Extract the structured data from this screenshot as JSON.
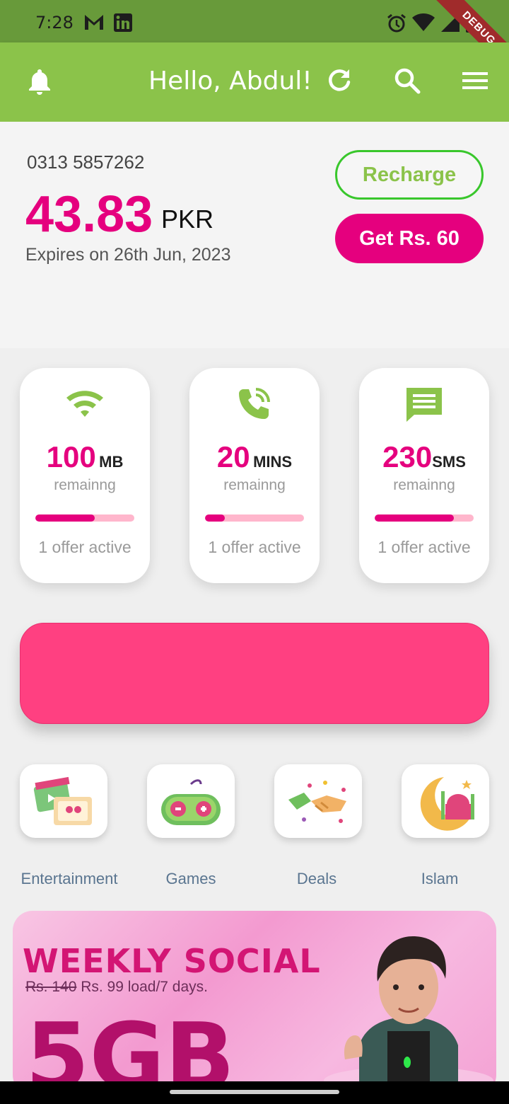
{
  "status_bar": {
    "time": "7:28",
    "debug_label": "DEBUG",
    "icons": [
      "gmail-icon",
      "linkedin-icon",
      "alarm-icon",
      "wifi-icon",
      "signal-icon",
      "battery-icon"
    ]
  },
  "app_bar": {
    "title": "Hello, Abdul!",
    "icons": [
      "bell-icon",
      "refresh-icon",
      "search-icon",
      "menu-icon"
    ],
    "color": "#8bc34a"
  },
  "account": {
    "phone_number": "0313 5857262",
    "balance": "43.83",
    "currency": "PKR",
    "expiry": "Expires on 26th Jun, 2023",
    "recharge_label": "Recharge",
    "get_label": "Get Rs. 60"
  },
  "usage": [
    {
      "icon": "wifi-icon",
      "amount": "100",
      "unit": "MB",
      "remaining_label": "remainng",
      "offer_label": "1 offer active",
      "progress": 0.6
    },
    {
      "icon": "phone-call-icon",
      "amount": "20",
      "unit": "MINS",
      "remaining_label": "remainng",
      "offer_label": "1 offer active",
      "progress": 0.2
    },
    {
      "icon": "message-icon",
      "amount": "230",
      "unit": "SMS",
      "remaining_label": "remainng",
      "offer_label": "1 offer active",
      "progress": 0.8
    }
  ],
  "categories": [
    {
      "label": "Entertainment",
      "icon": "entertainment-icon"
    },
    {
      "label": "Games",
      "icon": "gamepad-icon"
    },
    {
      "label": "Deals",
      "icon": "handshake-icon"
    },
    {
      "label": "Islam",
      "icon": "mosque-crescent-icon"
    }
  ],
  "promo": {
    "headline": "WEEKLY SOCIAL",
    "old_price": "Rs. 140",
    "offer_text": " Rs. 99 load/7 days.",
    "big_text": "5GB"
  },
  "colors": {
    "brand_pink": "#e5007e",
    "brand_green": "#8bc34a",
    "banner_pink": "#ff4081"
  }
}
